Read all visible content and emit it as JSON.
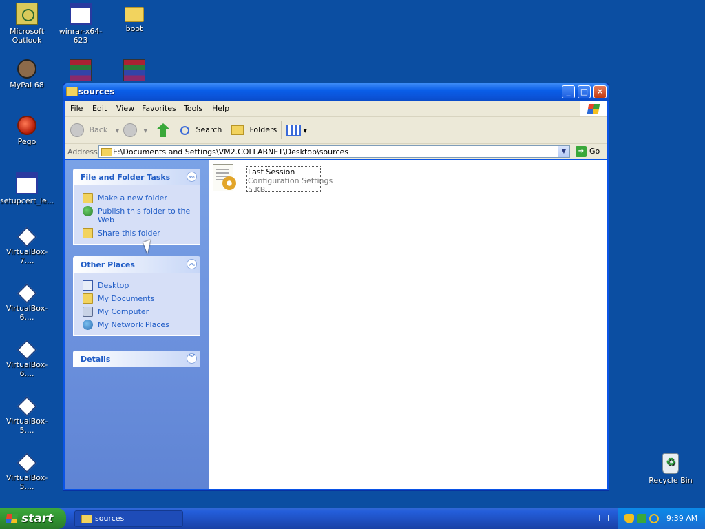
{
  "desktop": {
    "icons": [
      {
        "label_lines": [
          "Microsoft",
          "Outlook"
        ]
      },
      {
        "label_lines": [
          "winrar-x64-623"
        ]
      },
      {
        "label_lines": [
          "boot"
        ]
      },
      {
        "label_lines": [
          "MyPal 68"
        ]
      },
      {
        "label_lines": [
          "Pego"
        ]
      },
      {
        "label_lines": [
          "setupcert_le..."
        ]
      },
      {
        "label_lines": [
          "VirtualBox-7...."
        ]
      },
      {
        "label_lines": [
          "VirtualBox-6...."
        ]
      },
      {
        "label_lines": [
          "VirtualBox-6...."
        ]
      },
      {
        "label_lines": [
          "VirtualBox-5...."
        ]
      },
      {
        "label_lines": [
          "VirtualBox-5...."
        ]
      },
      {
        "label_lines": [
          "Recycle Bin"
        ]
      }
    ]
  },
  "window": {
    "title": "sources",
    "menu": [
      "File",
      "Edit",
      "View",
      "Favorites",
      "Tools",
      "Help"
    ],
    "toolbar": {
      "back": "Back",
      "search": "Search",
      "folders": "Folders"
    },
    "address": {
      "label": "Address",
      "path": "E:\\Documents and Settings\\VM2.COLLABNET\\Desktop\\sources",
      "go": "Go"
    },
    "tasks": {
      "title": "File and Folder Tasks",
      "items": [
        "Make a new folder",
        "Publish this folder to the Web",
        "Share this folder"
      ]
    },
    "places": {
      "title": "Other Places",
      "items": [
        "Desktop",
        "My Documents",
        "My Computer",
        "My Network Places"
      ]
    },
    "details": {
      "title": "Details"
    },
    "file": {
      "name": "Last Session",
      "type": "Configuration Settings",
      "size": "5 KB"
    }
  },
  "taskbar": {
    "start": "start",
    "item": "sources",
    "clock": "9:39 AM"
  }
}
